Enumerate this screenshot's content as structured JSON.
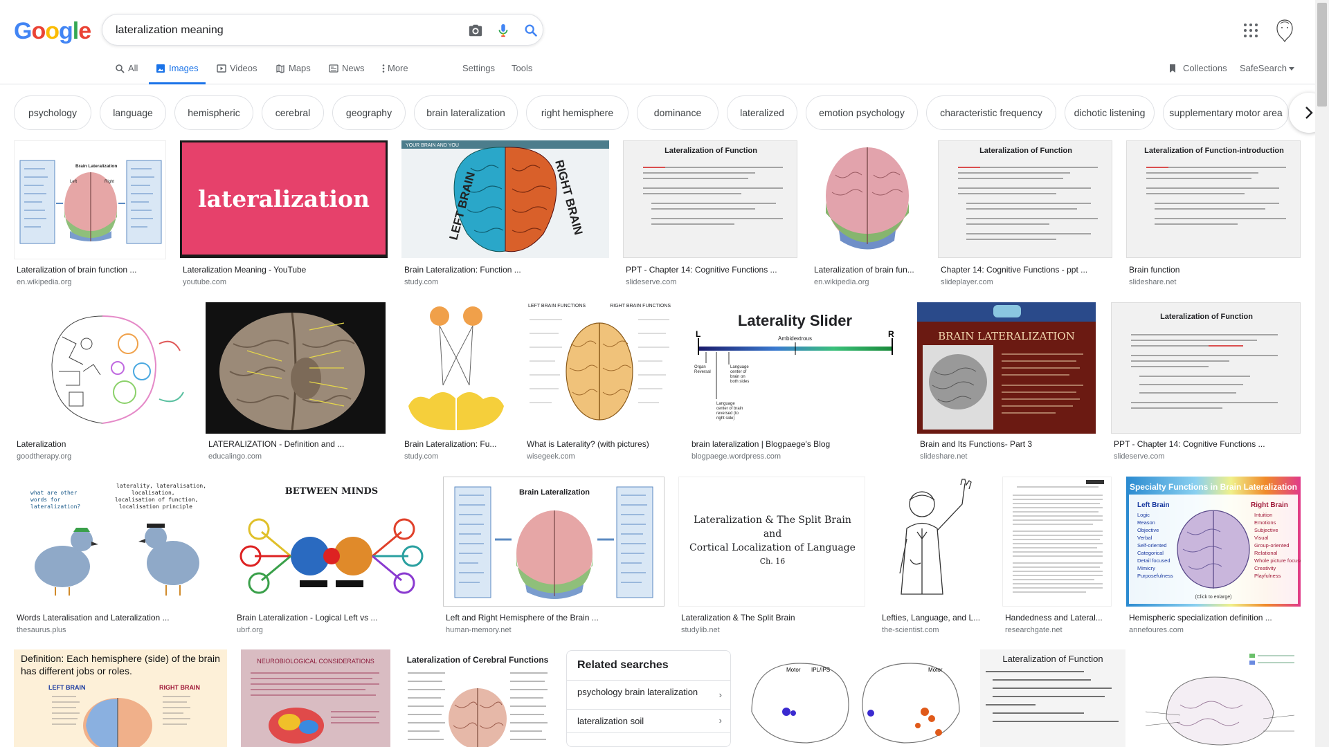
{
  "logo": [
    "G",
    "o",
    "o",
    "g",
    "l",
    "e"
  ],
  "logo_colors": [
    "#4285F4",
    "#EA4335",
    "#FBBC05",
    "#4285F4",
    "#34A853",
    "#EA4335"
  ],
  "search": {
    "query": "lateralization meaning"
  },
  "tabs": [
    {
      "label": "All",
      "icon": "search-icon"
    },
    {
      "label": "Images",
      "icon": "image-icon"
    },
    {
      "label": "Videos",
      "icon": "video-icon"
    },
    {
      "label": "Maps",
      "icon": "map-icon"
    },
    {
      "label": "News",
      "icon": "news-icon"
    },
    {
      "label": "More",
      "icon": "more-vert-icon"
    },
    {
      "label": "Settings"
    },
    {
      "label": "Tools"
    }
  ],
  "right_tools": {
    "collections": "Collections",
    "safesearch": "SafeSearch"
  },
  "chips": [
    "psychology",
    "language",
    "hemispheric",
    "cerebral",
    "geography",
    "brain lateralization",
    "right hemisphere",
    "dominance",
    "lateralized",
    "emotion psychology",
    "characteristic frequency",
    "dichotic listening",
    "supplementary motor area"
  ],
  "results": [
    {
      "caption": "Lateralization of brain function ...",
      "source": "en.wikipedia.org"
    },
    {
      "caption": "Lateralization Meaning - YouTube",
      "source": "youtube.com",
      "thumb_text": "lateralization"
    },
    {
      "caption": "Brain Lateralization: Function ...",
      "source": "study.com",
      "thumb_text_left": "LEFT BRAIN",
      "thumb_text_right": "RIGHT BRAIN",
      "thumb_banner": "YOUR BRAIN AND YOU"
    },
    {
      "caption": "PPT - Chapter 14: Cognitive Functions ...",
      "source": "slideserve.com",
      "thumb_title": "Lateralization of Function"
    },
    {
      "caption": "Lateralization of brain fun...",
      "source": "en.wikipedia.org"
    },
    {
      "caption": "Chapter 14: Cognitive Functions - ppt ...",
      "source": "slideplayer.com",
      "thumb_title": "Lateralization of Function"
    },
    {
      "caption": "Brain function",
      "source": "slideshare.net",
      "thumb_title": "Lateralization of Function-introduction"
    },
    {
      "caption": "Lateralization",
      "source": "goodtherapy.org"
    },
    {
      "caption": "LATERALIZATION - Definition and ...",
      "source": "educalingo.com"
    },
    {
      "caption": "Brain Lateralization: Fu...",
      "source": "study.com"
    },
    {
      "caption": "What is Laterality? (with pictures)",
      "source": "wisegeek.com",
      "thumb_left": "LEFT BRAIN FUNCTIONS",
      "thumb_right": "RIGHT BRAIN FUNCTIONS"
    },
    {
      "caption": "brain lateralization | Blogpaege's Blog",
      "source": "blogpaege.wordpress.com",
      "thumb_title": "Laterality Slider",
      "thumb_sub": "Ambidextrous"
    },
    {
      "caption": "Brain and Its Functions- Part 3",
      "source": "slideshare.net",
      "thumb_title": "BRAIN LATERALIZATION"
    },
    {
      "caption": "PPT - Chapter 14: Cognitive Functions ...",
      "source": "slideserve.com",
      "thumb_title": "Lateralization of Function"
    },
    {
      "caption": "Words Lateralisation and Lateralization ...",
      "source": "thesaurus.plus"
    },
    {
      "caption": "Brain Lateralization - Logical Left vs ...",
      "source": "ubrf.org",
      "thumb_title": "BETWEEN MINDS"
    },
    {
      "caption": "Left and Right Hemisphere of the Brain ...",
      "source": "human-memory.net",
      "thumb_title": "Brain Lateralization"
    },
    {
      "caption": "Lateralization & The Split Brain",
      "source": "studylib.net",
      "thumb_lines": [
        "Lateralization & The Split Brain",
        "and",
        "Cortical Localization of Language",
        "Ch. 16"
      ]
    },
    {
      "caption": "Lefties, Language, and L...",
      "source": "the-scientist.com"
    },
    {
      "caption": "Handedness and Lateral...",
      "source": "researchgate.net"
    },
    {
      "caption": "Hemispheric specialization definition ...",
      "source": "annefoures.com",
      "thumb_title": "Specialty Functions in Brain Lateralization"
    },
    {
      "thumb_text": "Definition: Each hemisphere (side) of the brain has different jobs or roles."
    },
    {
      "thumb_title": "NEUROBIOLOGICAL CONSIDERATIONS"
    },
    {
      "thumb_title": "Lateralization of Cerebral Functions"
    },
    {
      "thumb_labels": [
        "Motor",
        "IPL/IPS",
        "Motor"
      ]
    },
    {
      "thumb_title": "Lateralization of Function"
    },
    {}
  ],
  "related": {
    "title": "Related searches",
    "items": [
      "psychology brain lateralization",
      "lateralization soil"
    ]
  }
}
